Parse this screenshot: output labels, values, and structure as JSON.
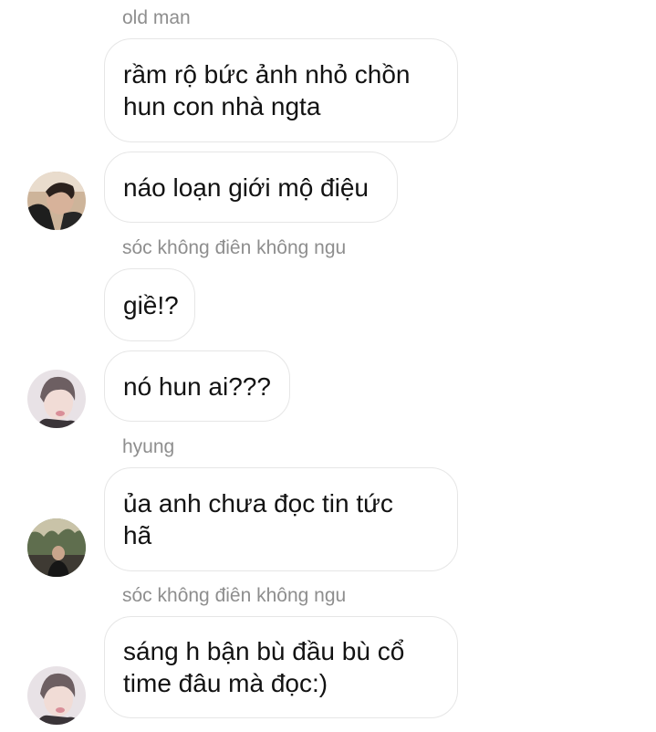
{
  "messages": [
    {
      "sender": "old man",
      "text": "rầm rộ bức ảnh nhỏ chồn\nhun con nhà ngta"
    },
    {
      "text": "náo loạn giới mộ điệu",
      "avatar": "avatar-man-dark-hair"
    },
    {
      "sender": "sóc không điên không ngu",
      "text": "giề!?"
    },
    {
      "text": "nó hun ai???",
      "avatar": "avatar-person-pale"
    },
    {
      "sender": "hyung",
      "text": "ủa anh chưa đọc tin tức\nhã",
      "avatar": "avatar-person-outdoor"
    },
    {
      "sender": "sóc không điên không ngu",
      "text": "sáng h bận bù đầu bù cổ\ntime đâu mà đọc:)",
      "avatar": "avatar-person-pale"
    }
  ]
}
